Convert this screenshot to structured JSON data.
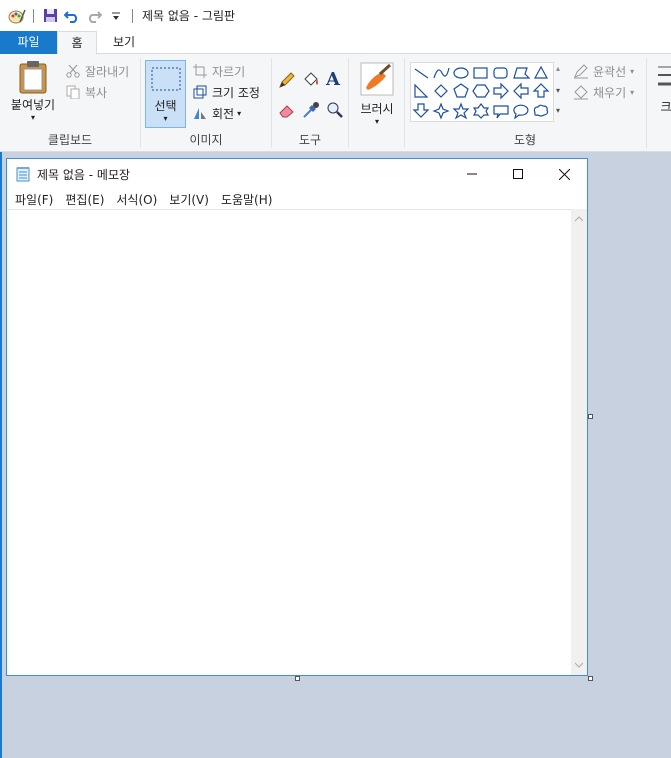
{
  "window": {
    "title": "제목 없음 - 그림판"
  },
  "tabs": {
    "file": "파일",
    "home": "홈",
    "view": "보기"
  },
  "clipboard": {
    "paste": "붙여넣기",
    "cut": "잘라내기",
    "copy": "복사",
    "label": "클립보드"
  },
  "image": {
    "select": "선택",
    "crop": "자르기",
    "resize": "크기 조정",
    "rotate": "회전",
    "label": "이미지"
  },
  "tools": {
    "label": "도구",
    "text_glyph": "A"
  },
  "brushes": {
    "label": "브러시"
  },
  "shapes": {
    "outline": "윤곽선",
    "fill": "채우기",
    "label": "도형",
    "items": [
      "line",
      "curve",
      "oval",
      "rectangle",
      "rounded-rectangle",
      "polygon",
      "triangle",
      "right-triangle",
      "diamond",
      "pentagon",
      "hexagon",
      "right-arrow",
      "left-arrow",
      "up-arrow",
      "down-arrow",
      "four-point-star",
      "five-point-star",
      "six-point-star",
      "rounded-callout",
      "oval-callout",
      "cloud-callout"
    ]
  },
  "size": {
    "label_partial": "크"
  },
  "notepad": {
    "title": "제목 없음 - 메모장",
    "menus": [
      "파일(F)",
      "편집(E)",
      "서식(O)",
      "보기(V)",
      "도움말(H)"
    ]
  },
  "colors": {
    "accent": "#1979ca",
    "ribbon_bg": "#f5f6f7",
    "workspace_bg": "#c8d1e0",
    "selected_btn": "#c9e0f7"
  }
}
